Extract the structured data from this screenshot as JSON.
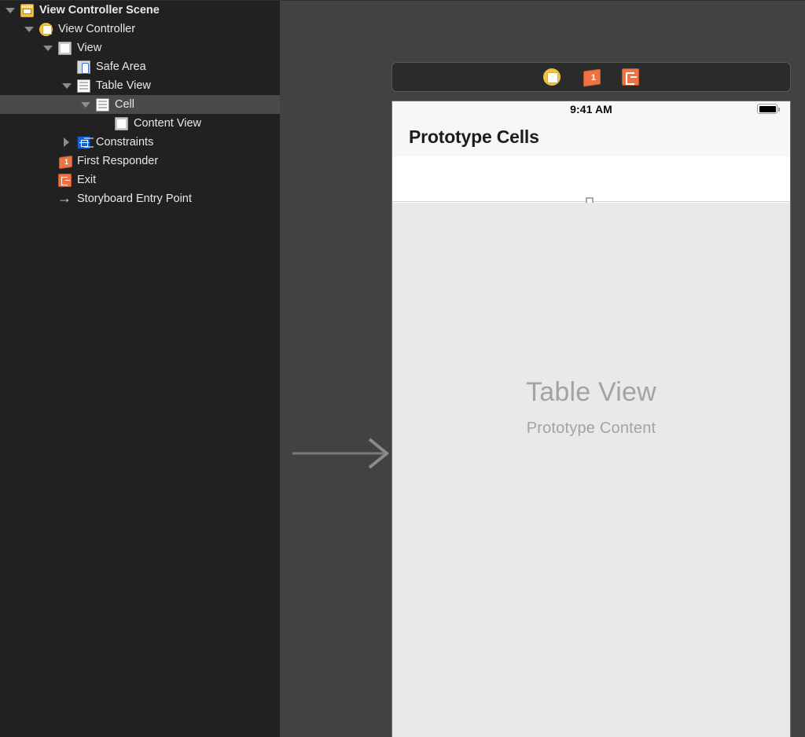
{
  "outline": {
    "rows": [
      {
        "label": "View Controller Scene",
        "icon": "scene-icon",
        "indent": 0,
        "disclosure": "down",
        "bold": true,
        "selected": false
      },
      {
        "label": "View Controller",
        "icon": "view-controller-icon",
        "indent": 1,
        "disclosure": "down",
        "bold": false,
        "selected": false
      },
      {
        "label": "View",
        "icon": "view-icon",
        "indent": 2,
        "disclosure": "down",
        "bold": false,
        "selected": false
      },
      {
        "label": "Safe Area",
        "icon": "safe-area-icon",
        "indent": 3,
        "disclosure": "none",
        "bold": false,
        "selected": false
      },
      {
        "label": "Table View",
        "icon": "table-view-icon",
        "indent": 3,
        "disclosure": "down",
        "bold": false,
        "selected": false
      },
      {
        "label": "Cell",
        "icon": "cell-icon",
        "indent": 4,
        "disclosure": "down",
        "bold": false,
        "selected": true
      },
      {
        "label": "Content View",
        "icon": "content-view-icon",
        "indent": 5,
        "disclosure": "none",
        "bold": false,
        "selected": false
      },
      {
        "label": "Constraints",
        "icon": "constraints-icon",
        "indent": 3,
        "disclosure": "right",
        "bold": false,
        "selected": false
      },
      {
        "label": "First Responder",
        "icon": "first-responder-icon",
        "indent": 2,
        "disclosure": "none",
        "bold": false,
        "selected": false
      },
      {
        "label": "Exit",
        "icon": "exit-icon",
        "indent": 2,
        "disclosure": "none",
        "bold": false,
        "selected": false
      },
      {
        "label": "Storyboard Entry Point",
        "icon": "arrow-right-icon",
        "indent": 2,
        "disclosure": "none",
        "bold": false,
        "selected": false
      }
    ]
  },
  "canvas": {
    "entry_point_arrow": "storyboard-entry-point-arrow",
    "scene_dock": {
      "items": [
        {
          "icon": "view-controller-icon",
          "name": "dock-view-controller"
        },
        {
          "icon": "first-responder-icon",
          "name": "dock-first-responder",
          "badge": "1"
        },
        {
          "icon": "exit-icon",
          "name": "dock-exit"
        }
      ]
    },
    "device": {
      "status_bar": {
        "time": "9:41 AM",
        "battery": "battery-full-icon"
      },
      "nav_bar": {
        "title": "Prototype Cells"
      },
      "prototype_cell": {
        "handle": "resize-handle"
      },
      "table_placeholder": {
        "title": "Table View",
        "subtitle": "Prototype Content"
      }
    }
  },
  "colors": {
    "sidebar_bg": "#212121",
    "canvas_bg": "#424242",
    "selection": "#4a4a4a",
    "accent_yellow": "#f2c23e",
    "accent_orange": "#ec7444",
    "accent_blue": "#1761d8",
    "placeholder_gray": "#a3a3a3"
  }
}
